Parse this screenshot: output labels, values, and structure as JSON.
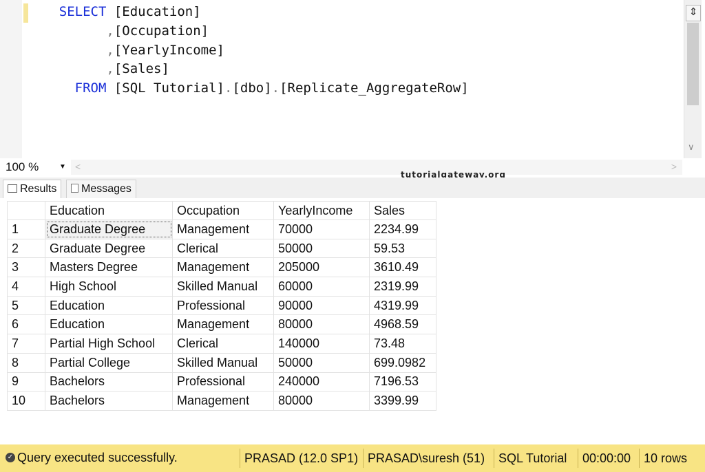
{
  "editor": {
    "lines": [
      {
        "kw": "SELECT",
        "text": " [Education]"
      },
      {
        "comma": ",",
        "text": "[Occupation]"
      },
      {
        "comma": ",",
        "text": "[YearlyIncome]"
      },
      {
        "comma": ",",
        "text": "[Sales]"
      },
      {
        "kw": "FROM",
        "text": " [SQL Tutorial]",
        "dot1": ".",
        "t2": "[dbo]",
        "dot2": ".",
        "t3": "[Replicate_AggregateRow]"
      }
    ]
  },
  "zoom": {
    "value": "100 %"
  },
  "watermark": "tutorialgateway.org",
  "tabs": {
    "results": "Results",
    "messages": "Messages"
  },
  "grid": {
    "columns": [
      "Education",
      "Occupation",
      "YearlyIncome",
      "Sales"
    ],
    "rows": [
      {
        "n": "1",
        "education": "Graduate Degree",
        "occupation": "Management",
        "income": "70000",
        "sales": "2234.99"
      },
      {
        "n": "2",
        "education": "Graduate Degree",
        "occupation": "Clerical",
        "income": "50000",
        "sales": "59.53"
      },
      {
        "n": "3",
        "education": "Masters Degree",
        "occupation": "Management",
        "income": "205000",
        "sales": "3610.49"
      },
      {
        "n": "4",
        "education": "High School",
        "occupation": "Skilled Manual",
        "income": "60000",
        "sales": "2319.99"
      },
      {
        "n": "5",
        "education": "Education",
        "occupation": "Professional",
        "income": "90000",
        "sales": "4319.99"
      },
      {
        "n": "6",
        "education": "Education",
        "occupation": "Management",
        "income": "80000",
        "sales": "4968.59"
      },
      {
        "n": "7",
        "education": "Partial High School",
        "occupation": "Clerical",
        "income": "140000",
        "sales": "73.48"
      },
      {
        "n": "8",
        "education": "Partial College",
        "occupation": "Skilled Manual",
        "income": "50000",
        "sales": "699.0982"
      },
      {
        "n": "9",
        "education": "Bachelors",
        "occupation": "Professional",
        "income": "240000",
        "sales": "7196.53"
      },
      {
        "n": "10",
        "education": "Bachelors",
        "occupation": "Management",
        "income": "80000",
        "sales": "3399.99"
      }
    ]
  },
  "status": {
    "message": "Query executed successfully.",
    "server": "PRASAD (12.0 SP1)",
    "user": "PRASAD\\suresh (51)",
    "database": "SQL Tutorial",
    "elapsed": "00:00:00",
    "rows": "10 rows"
  }
}
